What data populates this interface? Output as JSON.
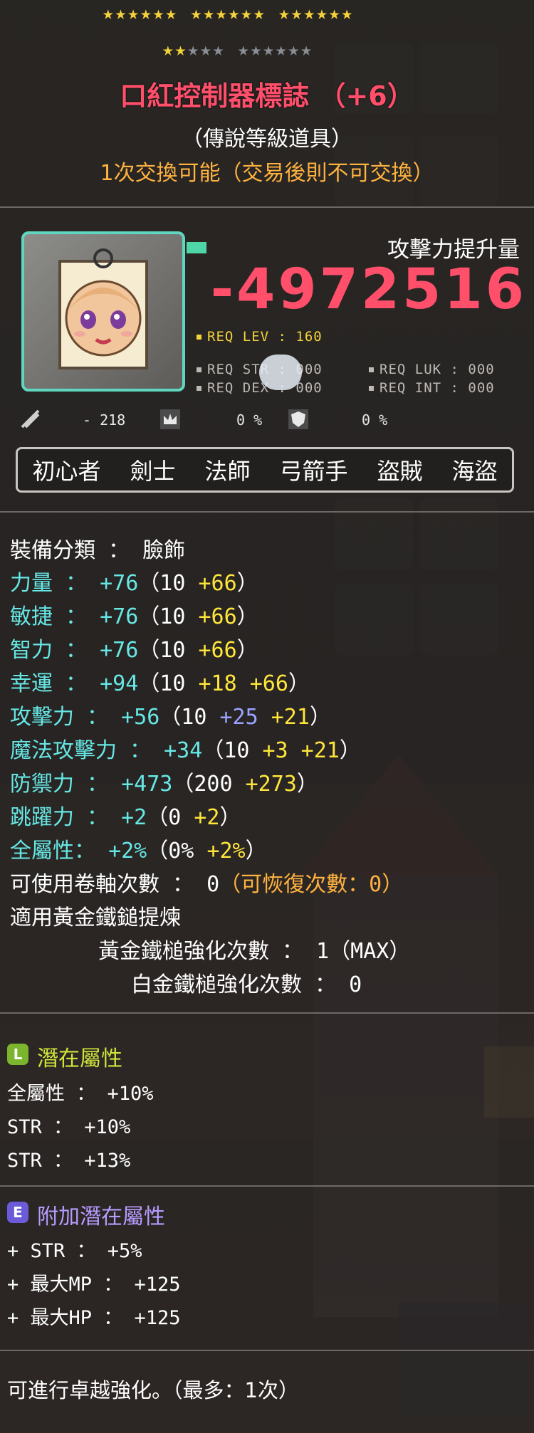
{
  "stars": {
    "row1": "★★★★★★ ★★★★★★ ★★★★★★",
    "row2_filled": "★★",
    "row2_empty": "★★★ ★★★★★★"
  },
  "item": {
    "name": "口紅控制器標誌 （+6）",
    "grade": "（傳說等級道具）",
    "tradable": "1次交換可能（交易後則不可交換）"
  },
  "attack_gain": {
    "label": "攻擊力提升量",
    "value": "-4972516"
  },
  "requirements": {
    "lev": "REQ LEV : 160",
    "str": "REQ STR : 000",
    "dex": "REQ DEX : 000",
    "luk": "REQ LUK : 000",
    "int": "REQ INT : 000"
  },
  "mini_stats": {
    "a": "- 218",
    "b": "0 %",
    "c": "0 %"
  },
  "classes": [
    "初心者",
    "劍士",
    "法師",
    "弓箭手",
    "盜賊",
    "海盜"
  ],
  "stats": {
    "category": "裝備分類 ： 臉飾",
    "str_label": "力量 ：",
    "str_total": "+76",
    "str_base": "（10 ",
    "str_bonus": "+66",
    "str_end": "）",
    "dex_label": "敏捷 ：",
    "dex_total": "+76",
    "dex_base": "（10 ",
    "dex_bonus": "+66",
    "dex_end": "）",
    "int_label": "智力 ：",
    "int_total": "+76",
    "int_base": "（10 ",
    "int_bonus": "+66",
    "int_end": "）",
    "luk_label": "幸運 ：",
    "luk_total": "+94",
    "luk_base": "（10 ",
    "luk_b1": "+18",
    "luk_b2": " +66",
    "luk_end": "）",
    "atk_label": "攻擊力 ：",
    "atk_total": "+56",
    "atk_base": "（10 ",
    "atk_b1": "+25",
    "atk_b2": " +21",
    "atk_end": "）",
    "matk_label": "魔法攻擊力 ：",
    "matk_total": "+34",
    "matk_base": "（10 ",
    "matk_b1": "+3",
    "matk_b2": " +21",
    "matk_end": "）",
    "def_label": "防禦力 ：",
    "def_total": "+473",
    "def_base": "（200 ",
    "def_bonus": "+273",
    "def_end": "）",
    "jump_label": "跳躍力 ：",
    "jump_total": "+2",
    "jump_base": "（0 ",
    "jump_bonus": "+2",
    "jump_end": "）",
    "all_label": "全屬性：",
    "all_total": "+2%",
    "all_base": "（0% ",
    "all_bonus": "+2%",
    "all_end": "）",
    "scroll": "可使用卷軸次數 ： 0",
    "scroll_recover": "（可恢復次數：0）",
    "hammer": "適用黃金鐵鎚提煉",
    "gold_hammer": "黃金鐵槌強化次數 ： 1（MAX）",
    "plat_hammer": "白金鐵槌強化次數 ： 0"
  },
  "potential": {
    "badge": "L",
    "title": "潛在屬性",
    "lines": [
      "全屬性 ： +10%",
      "STR ： +10%",
      "STR ： +13%"
    ]
  },
  "additional": {
    "badge": "E",
    "title": "附加潛在屬性",
    "lines": [
      "+ STR ： +5%",
      "+ 最大MP ： +125",
      "+ 最大HP ： +125"
    ]
  },
  "footer": "可進行卓越強化。（最多：1次）"
}
